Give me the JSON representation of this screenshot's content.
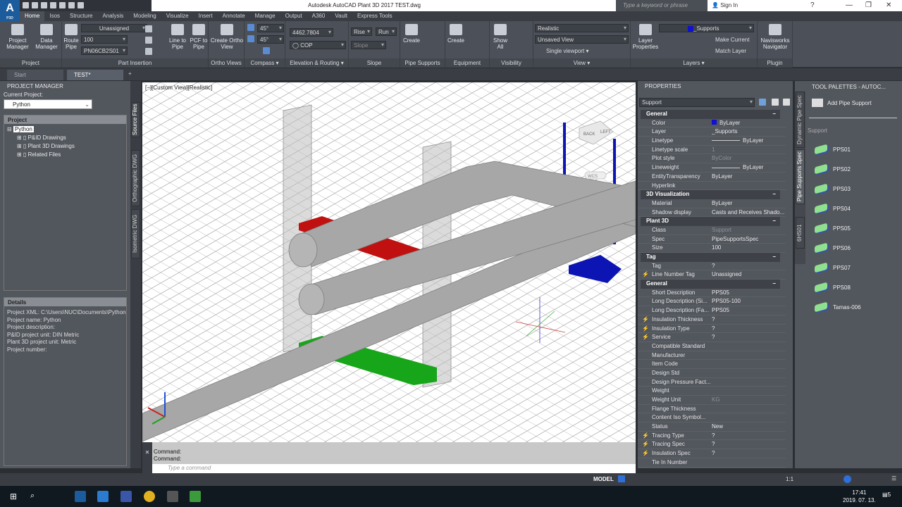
{
  "app": {
    "logo": "A",
    "logo_sub": "P3D",
    "title": "Autodesk AutoCAD Plant 3D 2017   TEST.dwg",
    "search_placeholder": "Type a keyword or phrase",
    "sign_in": "Sign In"
  },
  "ribbon_tabs": [
    "Home",
    "Isos",
    "Structure",
    "Analysis",
    "Modeling",
    "Visualize",
    "Insert",
    "Annotate",
    "Manage",
    "Output",
    "A360",
    "Vault",
    "Express Tools"
  ],
  "ribbon": {
    "project": {
      "title": "Project",
      "project_manager": "Project Manager",
      "data_manager": "Data Manager"
    },
    "part_insertion": {
      "title": "Part Insertion",
      "route_pipe": "Route Pipe",
      "line_number": "Unassigned",
      "size": "100",
      "spec": "PN06CB2S01",
      "line_to_pipe": "Line to Pipe",
      "pcf_to_pipe": "PCF to Pipe"
    },
    "ortho": {
      "title": "Ortho Views",
      "create": "Create Ortho View"
    },
    "compass": {
      "title": "Compass",
      "angle1": "45°",
      "angle2": "45°"
    },
    "elevation": {
      "title": "Elevation & Routing",
      "elevation": "4462.7804",
      "cop": "COP"
    },
    "slope": {
      "title": "Slope",
      "rise": "Rise",
      "run": "Run",
      "slope": "Slope"
    },
    "pipe_supports": {
      "title": "Pipe Supports",
      "create": "Create"
    },
    "equipment": {
      "title": "Equipment",
      "create": "Create"
    },
    "visibility": {
      "title": "Visibility",
      "show_all": "Show All"
    },
    "view": {
      "title": "View",
      "visual_style": "Realistic",
      "named_view": "Unsaved View",
      "viewport": "Single viewport"
    },
    "layers": {
      "title": "Layers",
      "layer_properties": "Layer Properties",
      "current_layer": "_Supports",
      "make_current": "Make Current",
      "match_layer": "Match Layer"
    },
    "plugin": {
      "title": "Plugin",
      "navisworks": "Navisworks Navigator"
    }
  },
  "file_tabs": [
    "Start",
    "TEST*"
  ],
  "project_manager": {
    "title": "PROJECT MANAGER",
    "current_label": "Current Project:",
    "current": "Python",
    "section": "Project",
    "tree": {
      "root": "Python",
      "children": [
        "P&ID Drawings",
        "Plant 3D Drawings",
        "Related Files"
      ]
    },
    "details_title": "Details",
    "details": [
      "Project XML:  C:\\Users\\NUC\\Documents\\Python",
      "Project name: Python",
      "Project description:",
      "P&ID project unit: DIN Metric",
      "Plant 3D project unit: Metric",
      "Project number:"
    ],
    "side_tabs": [
      "Source Files",
      "Orthographic DWG",
      "Isometric DWG"
    ]
  },
  "viewport": {
    "label": "[−][Custom View][Realistic]",
    "viewcube_face": "BACK",
    "viewcube_side": "LEFT",
    "wcs": "WCS"
  },
  "command": {
    "history": [
      "Command:",
      "Command:"
    ],
    "placeholder": "Type a command"
  },
  "properties": {
    "title": "PROPERTIES",
    "selection": "Support",
    "color_swatch": "#1010d0",
    "sections": [
      {
        "name": "General",
        "rows": [
          [
            "Color",
            "ByLayer"
          ],
          [
            "Layer",
            "_Supports"
          ],
          [
            "Linetype",
            "ByLayer"
          ],
          [
            "Linetype scale",
            "1"
          ],
          [
            "Plot style",
            "ByColor"
          ],
          [
            "Lineweight",
            "ByLayer"
          ],
          [
            "EntityTransparency",
            "ByLayer"
          ],
          [
            "Hyperlink",
            ""
          ]
        ]
      },
      {
        "name": "3D Visualization",
        "rows": [
          [
            "Material",
            "ByLayer"
          ],
          [
            "Shadow display",
            "Casts and Receives Shado..."
          ]
        ]
      },
      {
        "name": "Plant 3D",
        "rows": [
          [
            "Class",
            "Support"
          ],
          [
            "Spec",
            "PipeSupportsSpec"
          ],
          [
            "Size",
            "100"
          ]
        ]
      },
      {
        "name": "Tag",
        "rows": [
          [
            "Tag",
            "?"
          ],
          [
            "Line Number Tag",
            "Unassigned"
          ]
        ]
      },
      {
        "name": "General",
        "rows": [
          [
            "Short Description",
            "PPS05"
          ],
          [
            "Long Description (Si...",
            "PPS05-100"
          ],
          [
            "Long Description (Fa...",
            "PPS05"
          ],
          [
            "Insulation Thickness",
            "?"
          ],
          [
            "Insulation Type",
            "?"
          ],
          [
            "Service",
            "?"
          ],
          [
            "Compatible Standard",
            ""
          ],
          [
            "Manufacturer",
            ""
          ],
          [
            "Item Code",
            ""
          ],
          [
            "Design Std",
            ""
          ],
          [
            "Design Pressure Fact...",
            ""
          ],
          [
            "Weight",
            ""
          ],
          [
            "Weight Unit",
            "KG"
          ],
          [
            "Flange Thickness",
            ""
          ],
          [
            "Content Iso Symbol...",
            ""
          ],
          [
            "Status",
            "New"
          ],
          [
            "Tracing Type",
            "?"
          ],
          [
            "Tracing Spec",
            "?"
          ],
          [
            "Insulation Spec",
            "?"
          ],
          [
            "Tie In Number",
            ""
          ]
        ]
      }
    ],
    "bolt_rows": [
      "Line Number Tag",
      "Insulation Thickness",
      "Insulation Type",
      "Service",
      "Tracing Type",
      "Tracing Spec",
      "Insulation Spec"
    ],
    "dim_values": [
      "1",
      "ByColor",
      "Support",
      "KG"
    ]
  },
  "tool_palettes": {
    "title": "TOOL PALETTES - AUTOC...",
    "add": "Add Pipe Support",
    "group": "Support",
    "items": [
      "PPS01",
      "PPS02",
      "PPS03",
      "PPS04",
      "PPS05",
      "PPS06",
      "PPS07",
      "PPS08",
      "Tamas-006"
    ],
    "side_tabs": [
      "Dynamic Pipe Spec",
      "Pipe Supports Spec",
      "6HS01"
    ]
  },
  "status_bar": {
    "model": "MODEL",
    "scale": "1:1"
  },
  "taskbar": {
    "time": "17:41",
    "date": "2019. 07. 13.",
    "notifications": "5"
  }
}
